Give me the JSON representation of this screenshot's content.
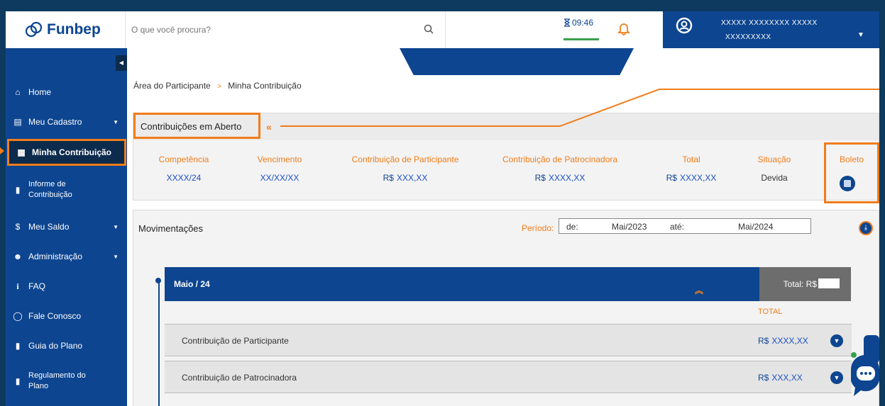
{
  "brand": {
    "name": "Funbep",
    "accent": "#f07d1a",
    "primary": "#0d4590"
  },
  "header": {
    "search_placeholder": "O que você procura?",
    "timer": "09:46",
    "user_name": "XXXXX XXXXXXXX XXXXX",
    "user_id": "XXXXXXXXX"
  },
  "sidebar": {
    "items": [
      {
        "label": "Home",
        "icon": "home-icon"
      },
      {
        "label": "Meu Cadastro",
        "icon": "id-card-icon",
        "expandable": true
      },
      {
        "label": "Minha Contribuição",
        "icon": "calculator-icon",
        "active": true
      },
      {
        "label": "Informe de Contribuição",
        "icon": "document-icon"
      },
      {
        "label": "Meu Saldo",
        "icon": "dollar-icon",
        "expandable": true
      },
      {
        "label": "Administração",
        "icon": "users-icon",
        "expandable": true
      },
      {
        "label": "FAQ",
        "icon": "info-icon"
      },
      {
        "label": "Fale Conosco",
        "icon": "chat-icon"
      },
      {
        "label": "Guia do Plano",
        "icon": "book-icon"
      },
      {
        "label": "Regulamento do Plano",
        "icon": "book-icon"
      }
    ]
  },
  "breadcrumb": {
    "parent": "Área do Participante",
    "separator": ">",
    "current": "Minha Contribuição"
  },
  "open_contributions": {
    "title": "Contribuições em Aberto",
    "columns": [
      "Competência",
      "Vencimento",
      "Contribuição de Participante",
      "Contribuição de Patrocinadora",
      "Total",
      "Situação",
      "Boleto"
    ],
    "row": {
      "competencia": "XXXX/24",
      "vencimento": "XX/XX/XX",
      "participante_currency": "R$",
      "participante": "XXX,XX",
      "patrocinadora_currency": "R$",
      "patrocinadora": "XXXX,XX",
      "total_currency": "R$",
      "total": "XXXX,XX",
      "situacao": "Devida"
    }
  },
  "movements": {
    "title": "Movimentações",
    "period_label": "Período:",
    "from_label": "de:",
    "from_value": "Mai/2023",
    "to_label": "até:",
    "to_value": "Mai/2024",
    "month": "Maio / 24",
    "total_label": "Total: R$",
    "total_column": "TOTAL",
    "rows": [
      {
        "label": "Contribuição de Participante",
        "currency": "R$",
        "value": "XXXX,XX"
      },
      {
        "label": "Contribuição de Patrocinadora",
        "currency": "R$",
        "value": "XXX,XX"
      }
    ]
  }
}
